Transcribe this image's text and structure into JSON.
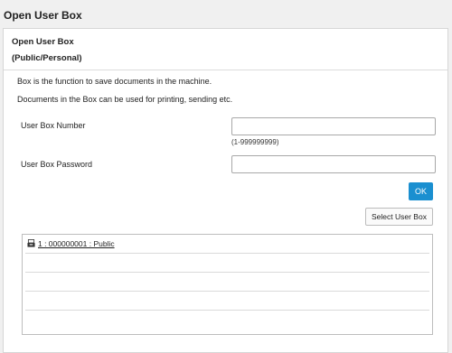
{
  "page": {
    "title": "Open User Box"
  },
  "panel": {
    "title_line1": "Open User Box",
    "title_line2": "(Public/Personal)",
    "description_1": "Box is the function to save documents in the machine.",
    "description_2": "Documents in the Box can be used for printing, sending etc."
  },
  "form": {
    "user_box_number_label": "User Box Number",
    "user_box_number_value": "",
    "user_box_number_hint": "(1-999999999)",
    "user_box_password_label": "User Box Password",
    "user_box_password_value": "",
    "ok_label": "OK",
    "select_user_box_label": "Select User Box"
  },
  "box_list": {
    "items": [
      {
        "label": "1 : 000000001 : Public",
        "icon": "box-tray-icon"
      }
    ],
    "empty_rows": 4
  },
  "colors": {
    "accent": "#1a8fd0",
    "background": "#f0f0f0",
    "panel": "#ffffff"
  }
}
